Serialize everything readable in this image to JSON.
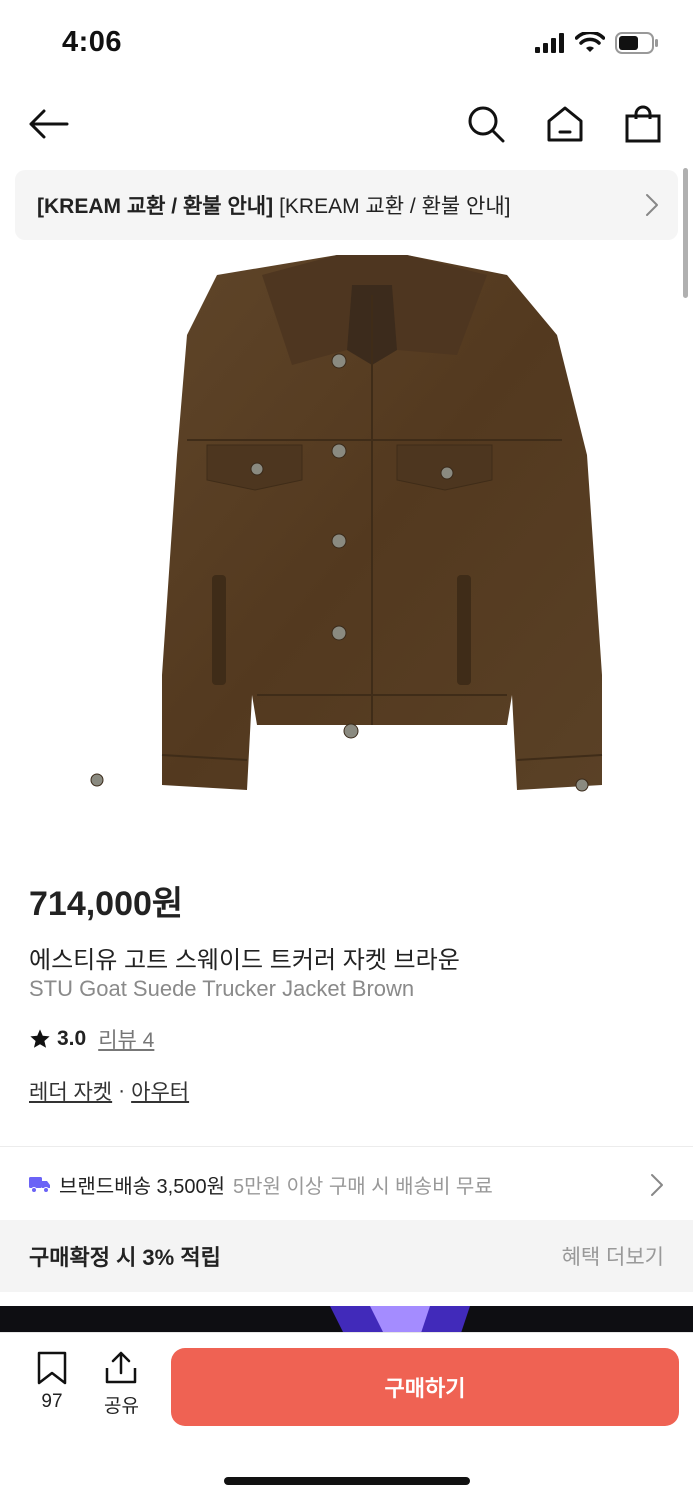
{
  "status": {
    "time": "4:06"
  },
  "notice": {
    "bold": "[KREAM 교환 / 환불 안내]",
    "text": "[KREAM 교환 / 환불 안내]"
  },
  "product": {
    "price": "714,000원",
    "name_ko": "에스티유 고트 스웨이드 트커러 자켓 브라운",
    "name_en": "STU Goat Suede Trucker Jacket Brown",
    "rating": "3.0",
    "reviews": "리뷰 4",
    "categories": [
      "레더 자켓",
      "아우터"
    ],
    "category_sep": "·",
    "jacket_color": "#5a4228"
  },
  "shipping": {
    "main": "브랜드배송 3,500원",
    "sub": "5만원 이상 구매 시 배송비 무료",
    "icon_color": "#6b63f6"
  },
  "benefit": {
    "label": "구매확정 시 3% 적립",
    "more": "혜택 더보기"
  },
  "bottom": {
    "bookmark_count": "97",
    "share_label": "공유",
    "buy_label": "구매하기",
    "buy_color": "#ef6253"
  }
}
